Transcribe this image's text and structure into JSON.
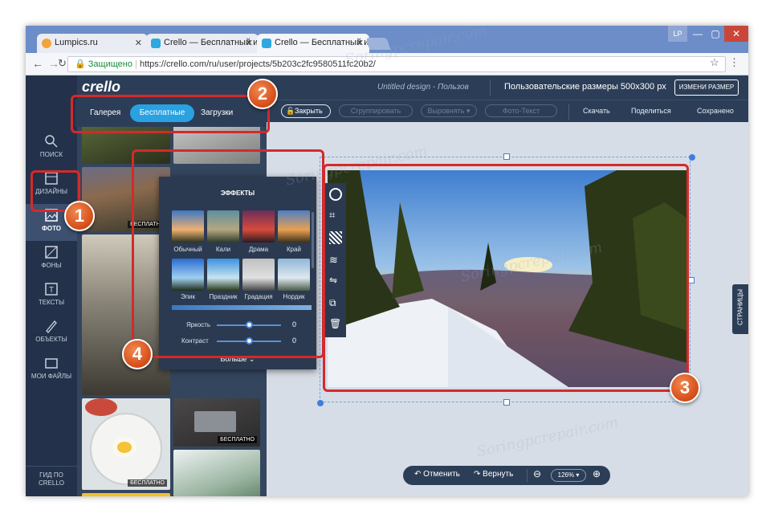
{
  "browser": {
    "tabs": [
      {
        "title": "Lumpics.ru",
        "favicon_color": "#f2a33a"
      },
      {
        "title": "Crello — Бесплатный ин",
        "favicon_color": "#2da8e0"
      },
      {
        "title": "Crello — Бесплатный ин",
        "favicon_color": "#2da8e0"
      }
    ],
    "profile": "LP",
    "secure_label": "Защищено",
    "url": "https://crello.com/ru/user/projects/5b203c2fc9580511fc20b2/"
  },
  "app": {
    "logo": "crello",
    "design_title": "Untitled design - Пользов",
    "size_label": "Пользовательские размеры 500x300 px",
    "resize_button": "ИЗМЕНИ РАЗМЕР"
  },
  "panel": {
    "tabs": [
      "Галерея",
      "Бесплатные",
      "Загрузки"
    ],
    "active_tab": "Бесплатные",
    "badge": "БЕСПЛАТНО"
  },
  "toolbar": {
    "close": "Закрыть",
    "group": "Сгруппировать",
    "align": "Выровнять",
    "photo_text": "Фото-Текст",
    "download": "Скачать",
    "share": "Поделиться",
    "saved": "Сохранено"
  },
  "rail": [
    {
      "label": "ПОИСК",
      "icon": "search-icon"
    },
    {
      "label": "ДИЗАЙНЫ",
      "icon": "layout-icon"
    },
    {
      "label": "ФОТО",
      "icon": "image-icon"
    },
    {
      "label": "ФОНЫ",
      "icon": "background-icon"
    },
    {
      "label": "ТЕКСТЫ",
      "icon": "text-icon"
    },
    {
      "label": "ОБЪЕКТЫ",
      "icon": "objects-icon"
    },
    {
      "label": "МОИ ФАЙЛЫ",
      "icon": "folder-icon"
    }
  ],
  "rail_bottom": "ГИД ПО CRELLO",
  "effects": {
    "title": "ЭФФЕКТЫ",
    "filters": [
      "Обычный",
      "Кали",
      "Драма",
      "Край",
      "Эпик",
      "Праздник",
      "Градация",
      "Нордик"
    ],
    "brightness_label": "Яркость",
    "brightness_value": "0",
    "contrast_label": "Контраст",
    "contrast_value": "0",
    "more": "Больше"
  },
  "pages_label": "СТРАНИЦЫ",
  "history": {
    "undo": "Отменить",
    "redo": "Вернуть",
    "zoom": "126%"
  },
  "annotations": [
    "1",
    "2",
    "3",
    "4"
  ],
  "watermark": "Soringpcrepair.com"
}
